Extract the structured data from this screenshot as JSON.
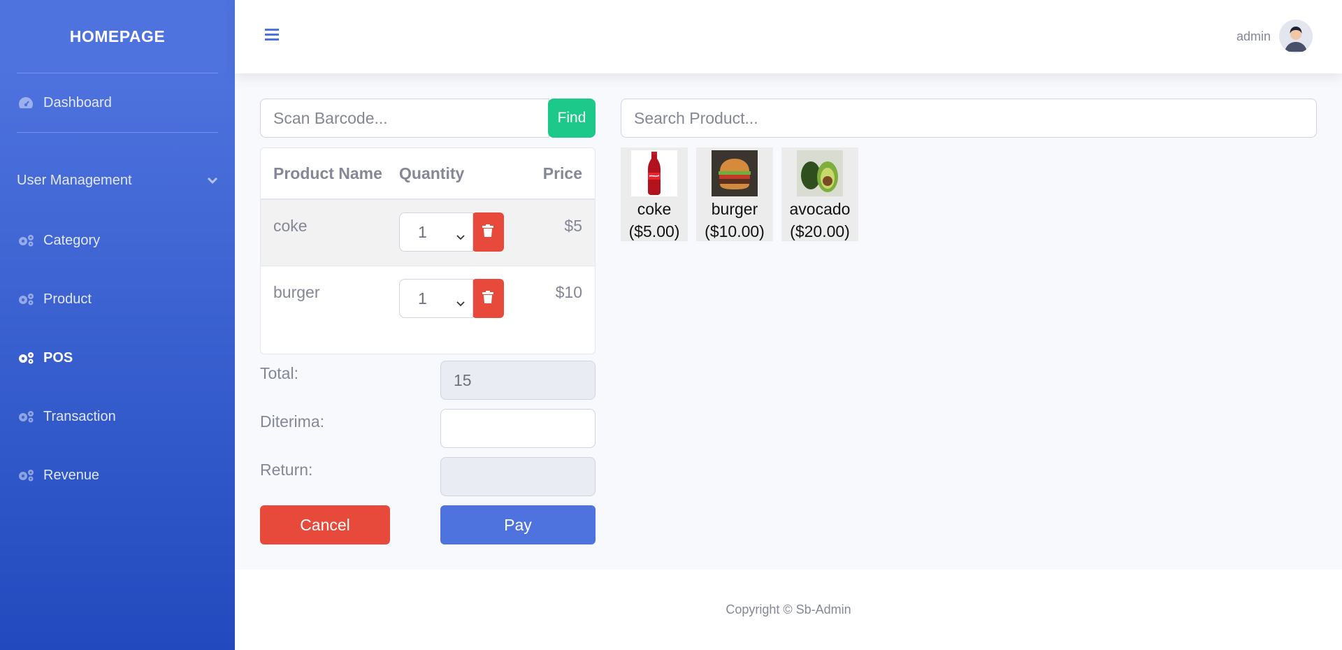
{
  "sidebar": {
    "brand": "HOMEPAGE",
    "items": [
      {
        "label": "Dashboard",
        "icon": "tachometer-icon"
      },
      {
        "label": "User Management",
        "icon": "none"
      },
      {
        "label": "Category",
        "icon": "cogs-icon"
      },
      {
        "label": "Product",
        "icon": "cogs-icon"
      },
      {
        "label": "POS",
        "icon": "cogs-icon",
        "active": true
      },
      {
        "label": "Transaction",
        "icon": "cogs-icon"
      },
      {
        "label": "Revenue",
        "icon": "cogs-icon"
      }
    ]
  },
  "topbar": {
    "user_name": "admin"
  },
  "pos": {
    "barcode_placeholder": "Scan Barcode...",
    "find_label": "Find",
    "search_placeholder": "Search Product...",
    "cart": {
      "headers": [
        "Product Name",
        "Quantity",
        "Price"
      ],
      "rows": [
        {
          "name": "coke",
          "qty": "1",
          "price": "$5"
        },
        {
          "name": "burger",
          "qty": "1",
          "price": "$10"
        }
      ]
    },
    "total_label": "Total:",
    "total_value": "15",
    "received_label": "Diterima:",
    "received_value": "",
    "return_label": "Return:",
    "return_value": "",
    "cancel_label": "Cancel",
    "pay_label": "Pay",
    "products": [
      {
        "name": "coke",
        "price": "($5.00)"
      },
      {
        "name": "burger",
        "price": "($10.00)"
      },
      {
        "name": "avocado",
        "price": "($20.00)"
      }
    ]
  },
  "footer": {
    "text": "Copyright © Sb-Admin"
  },
  "colors": {
    "primary": "#4e73df",
    "success": "#1cc88a",
    "danger": "#e74a3b"
  }
}
